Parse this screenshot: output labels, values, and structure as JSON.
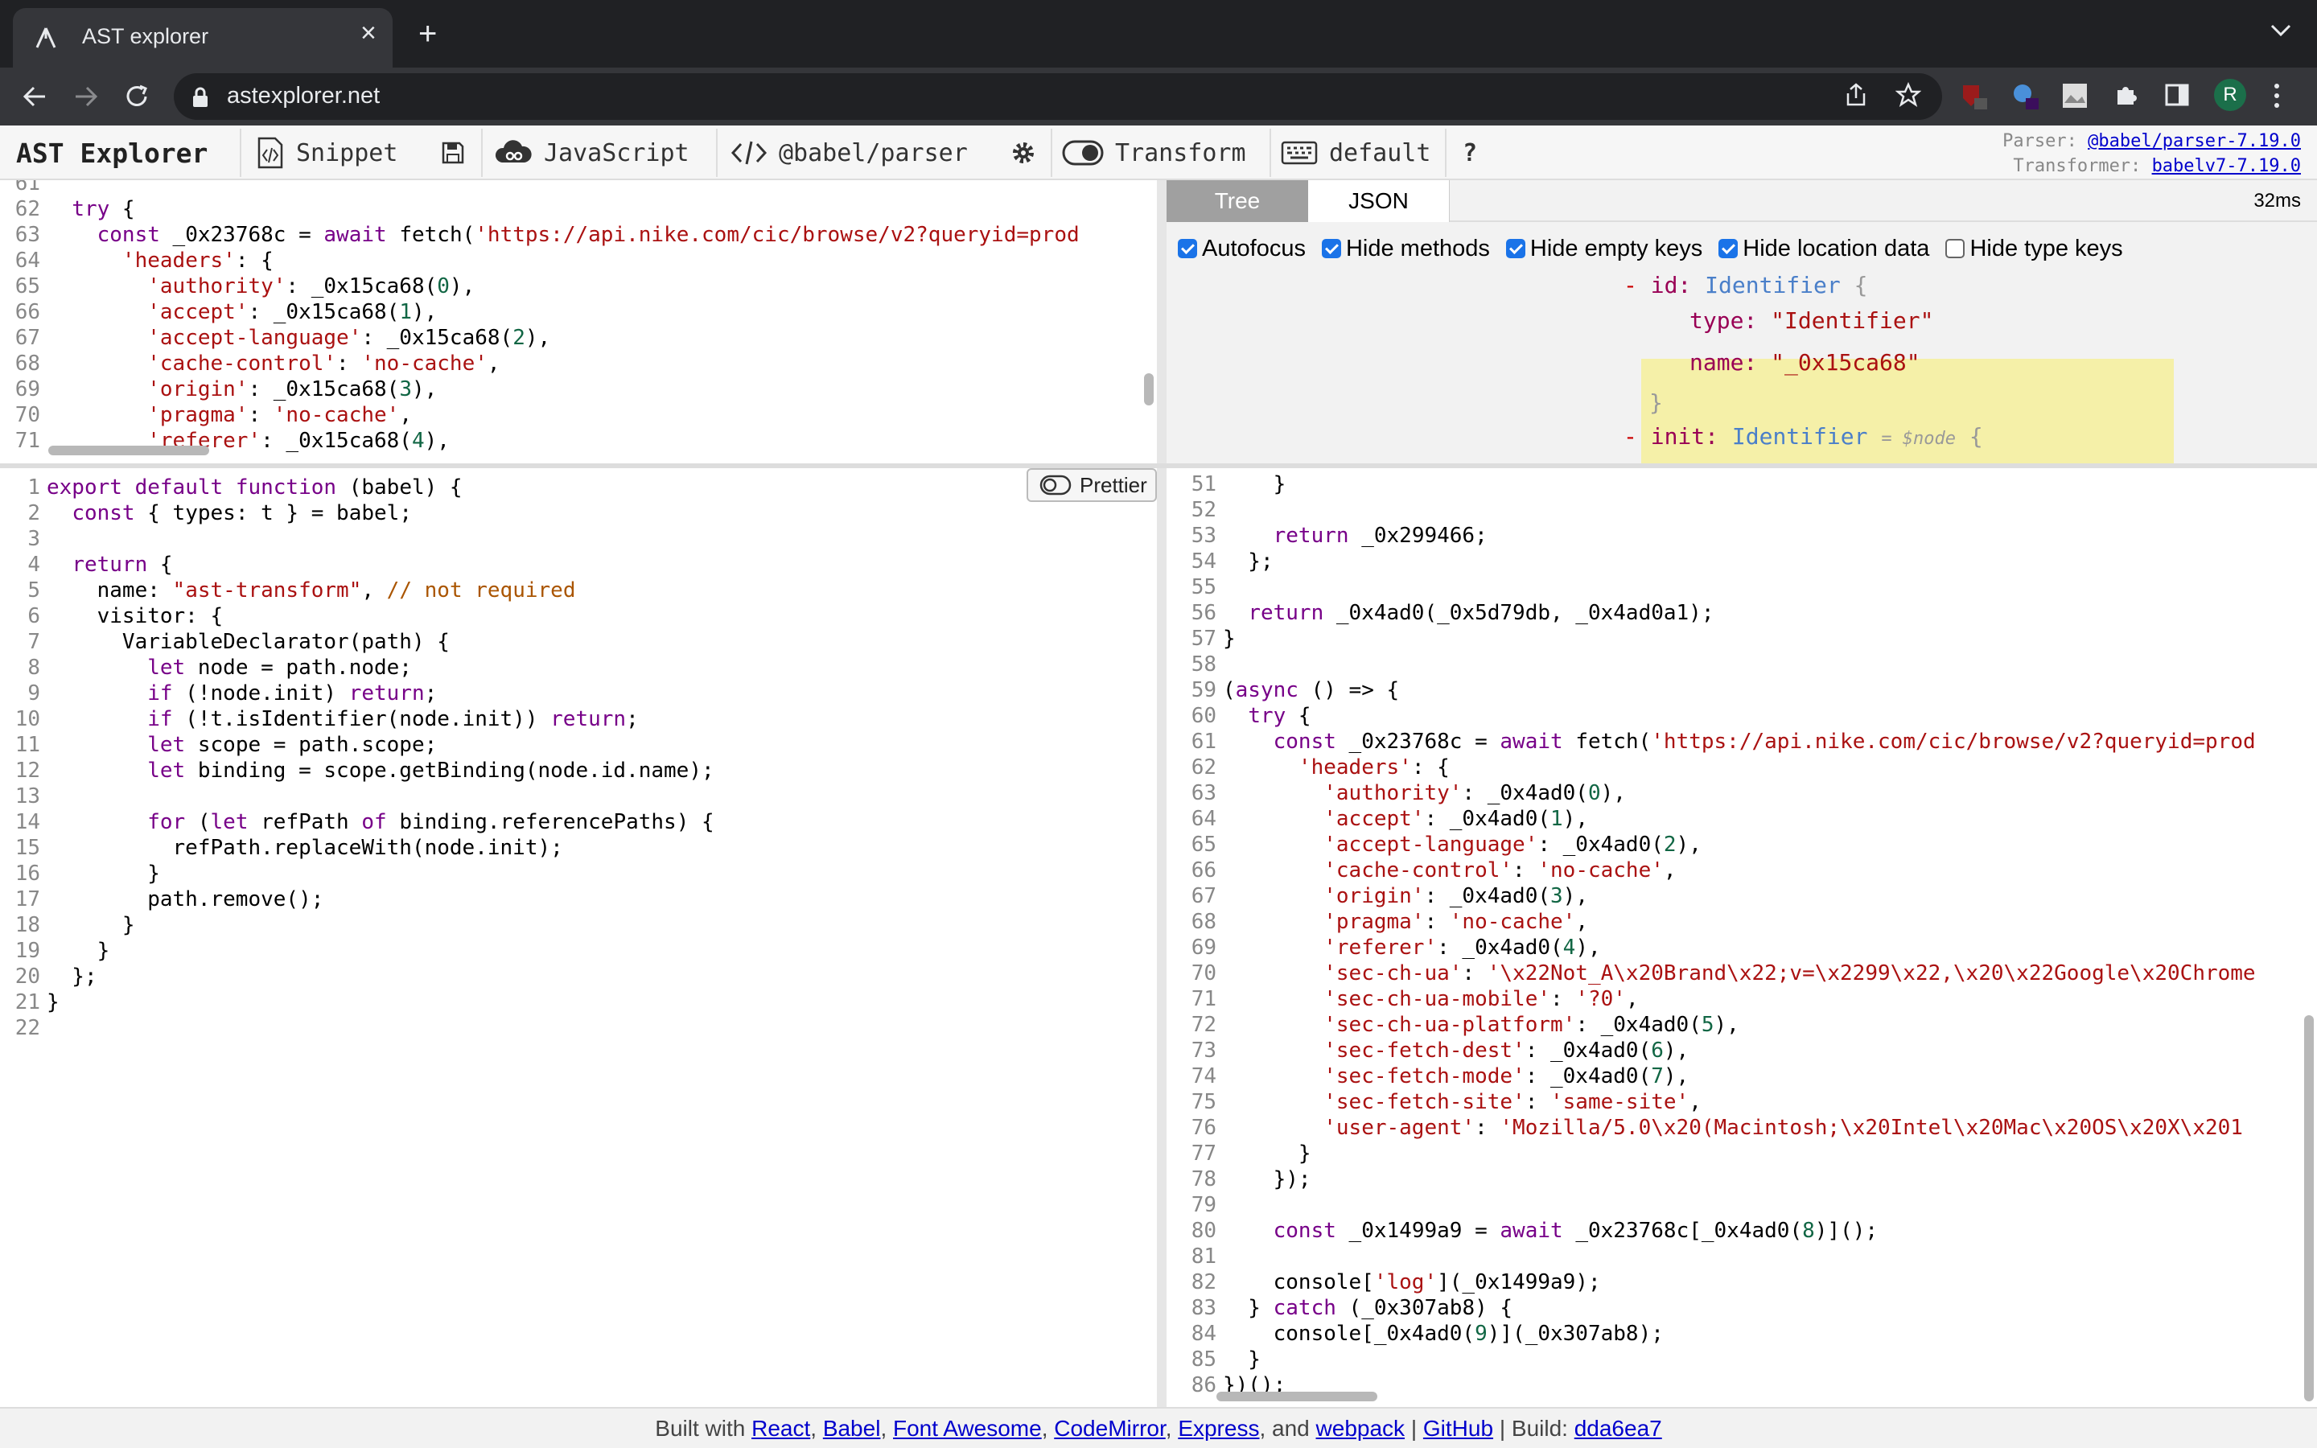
{
  "browser": {
    "tab_title": "AST explorer",
    "url": "astexplorer.net"
  },
  "appbar": {
    "brand": "AST Explorer",
    "snippet": "Snippet",
    "language": "JavaScript",
    "parser": "@babel/parser",
    "transform": "Transform",
    "keymap": "default",
    "help": "?",
    "parser_label": "Parser:",
    "parser_version": "@babel/parser-7.19.0",
    "transformer_label": "Transformer:",
    "transformer_version": "babelv7-7.19.0"
  },
  "ast_panel": {
    "tabs": [
      "Tree",
      "JSON"
    ],
    "time": "32ms",
    "options": [
      {
        "label": "Autofocus",
        "checked": true
      },
      {
        "label": "Hide methods",
        "checked": true
      },
      {
        "label": "Hide empty keys",
        "checked": true
      },
      {
        "label": "Hide location data",
        "checked": true
      },
      {
        "label": "Hide type keys",
        "checked": false
      }
    ],
    "tree": {
      "id_key": "id:",
      "id_type": "Identifier",
      "brace_open": "{",
      "type_key": "type:",
      "type_val": "\"Identifier\"",
      "name_key": "name:",
      "name_val": "\"_0x15ca68\"",
      "brace_close": "}",
      "init_key": "init:",
      "init_type": "Identifier",
      "init_node": "= $node",
      "collapse": "-"
    }
  },
  "prettier_label": "Prettier",
  "source_editor": {
    "lines": [
      {
        "n": "61",
        "t": ""
      },
      {
        "n": "62",
        "t": "  try {"
      },
      {
        "n": "63",
        "t": "    const _0x23768c = await fetch('https://api.nike.com/cic/browse/v2?queryid=prod"
      },
      {
        "n": "64",
        "t": "      'headers': {"
      },
      {
        "n": "65",
        "t": "        'authority': _0x15ca68(0),"
      },
      {
        "n": "66",
        "t": "        'accept': _0x15ca68(1),"
      },
      {
        "n": "67",
        "t": "        'accept-language': _0x15ca68(2),"
      },
      {
        "n": "68",
        "t": "        'cache-control': 'no-cache',"
      },
      {
        "n": "69",
        "t": "        'origin': _0x15ca68(3),"
      },
      {
        "n": "70",
        "t": "        'pragma': 'no-cache',"
      },
      {
        "n": "71",
        "t": "        'referer': _0x15ca68(4),"
      }
    ]
  },
  "transform_editor": {
    "lines": [
      {
        "n": "1",
        "t": "export default function (babel) {"
      },
      {
        "n": "2",
        "t": "  const { types: t } = babel;"
      },
      {
        "n": "3",
        "t": ""
      },
      {
        "n": "4",
        "t": "  return {"
      },
      {
        "n": "5",
        "t": "    name: \"ast-transform\", // not required"
      },
      {
        "n": "6",
        "t": "    visitor: {"
      },
      {
        "n": "7",
        "t": "      VariableDeclarator(path) {"
      },
      {
        "n": "8",
        "t": "        let node = path.node;"
      },
      {
        "n": "9",
        "t": "        if (!node.init) return;"
      },
      {
        "n": "10",
        "t": "        if (!t.isIdentifier(node.init)) return;"
      },
      {
        "n": "11",
        "t": "        let scope = path.scope;"
      },
      {
        "n": "12",
        "t": "        let binding = scope.getBinding(node.id.name);"
      },
      {
        "n": "13",
        "t": ""
      },
      {
        "n": "14",
        "t": "        for (let refPath of binding.referencePaths) {"
      },
      {
        "n": "15",
        "t": "          refPath.replaceWith(node.init);"
      },
      {
        "n": "16",
        "t": "        }"
      },
      {
        "n": "17",
        "t": "        path.remove();"
      },
      {
        "n": "18",
        "t": "      }"
      },
      {
        "n": "19",
        "t": "    }"
      },
      {
        "n": "20",
        "t": "  };"
      },
      {
        "n": "21",
        "t": "}"
      },
      {
        "n": "22",
        "t": ""
      }
    ]
  },
  "output_editor": {
    "lines": [
      {
        "n": "51",
        "t": "    }"
      },
      {
        "n": "52",
        "t": ""
      },
      {
        "n": "53",
        "t": "    return _0x299466;"
      },
      {
        "n": "54",
        "t": "  };"
      },
      {
        "n": "55",
        "t": ""
      },
      {
        "n": "56",
        "t": "  return _0x4ad0(_0x5d79db, _0x4ad0a1);"
      },
      {
        "n": "57",
        "t": "}"
      },
      {
        "n": "58",
        "t": ""
      },
      {
        "n": "59",
        "t": "(async () => {"
      },
      {
        "n": "60",
        "t": "  try {"
      },
      {
        "n": "61",
        "t": "    const _0x23768c = await fetch('https://api.nike.com/cic/browse/v2?queryid=prod"
      },
      {
        "n": "62",
        "t": "      'headers': {"
      },
      {
        "n": "63",
        "t": "        'authority': _0x4ad0(0),"
      },
      {
        "n": "64",
        "t": "        'accept': _0x4ad0(1),"
      },
      {
        "n": "65",
        "t": "        'accept-language': _0x4ad0(2),"
      },
      {
        "n": "66",
        "t": "        'cache-control': 'no-cache',"
      },
      {
        "n": "67",
        "t": "        'origin': _0x4ad0(3),"
      },
      {
        "n": "68",
        "t": "        'pragma': 'no-cache',"
      },
      {
        "n": "69",
        "t": "        'referer': _0x4ad0(4),"
      },
      {
        "n": "70",
        "t": "        'sec-ch-ua': '\\x22Not_A\\x20Brand\\x22;v=\\x2299\\x22,\\x20\\x22Google\\x20Chrome"
      },
      {
        "n": "71",
        "t": "        'sec-ch-ua-mobile': '?0',"
      },
      {
        "n": "72",
        "t": "        'sec-ch-ua-platform': _0x4ad0(5),"
      },
      {
        "n": "73",
        "t": "        'sec-fetch-dest': _0x4ad0(6),"
      },
      {
        "n": "74",
        "t": "        'sec-fetch-mode': _0x4ad0(7),"
      },
      {
        "n": "75",
        "t": "        'sec-fetch-site': 'same-site',"
      },
      {
        "n": "76",
        "t": "        'user-agent': 'Mozilla/5.0\\x20(Macintosh;\\x20Intel\\x20Mac\\x20OS\\x20X\\x201"
      },
      {
        "n": "77",
        "t": "      }"
      },
      {
        "n": "78",
        "t": "    });"
      },
      {
        "n": "79",
        "t": ""
      },
      {
        "n": "80",
        "t": "    const _0x1499a9 = await _0x23768c[_0x4ad0(8)]();"
      },
      {
        "n": "81",
        "t": ""
      },
      {
        "n": "82",
        "t": "    console['log'](_0x1499a9);"
      },
      {
        "n": "83",
        "t": "  } catch (_0x307ab8) {"
      },
      {
        "n": "84",
        "t": "    console[_0x4ad0(9)](_0x307ab8);"
      },
      {
        "n": "85",
        "t": "  }"
      },
      {
        "n": "86",
        "t": "})();"
      }
    ]
  },
  "footer": {
    "built_with": "Built with",
    "react": "React",
    "babel": "Babel",
    "font_awesome": "Font Awesome",
    "codemirror": "CodeMirror",
    "express": "Express",
    "and": "and",
    "webpack": "webpack",
    "github": "GitHub",
    "build_label": "Build:",
    "build": "dda6ea7"
  }
}
